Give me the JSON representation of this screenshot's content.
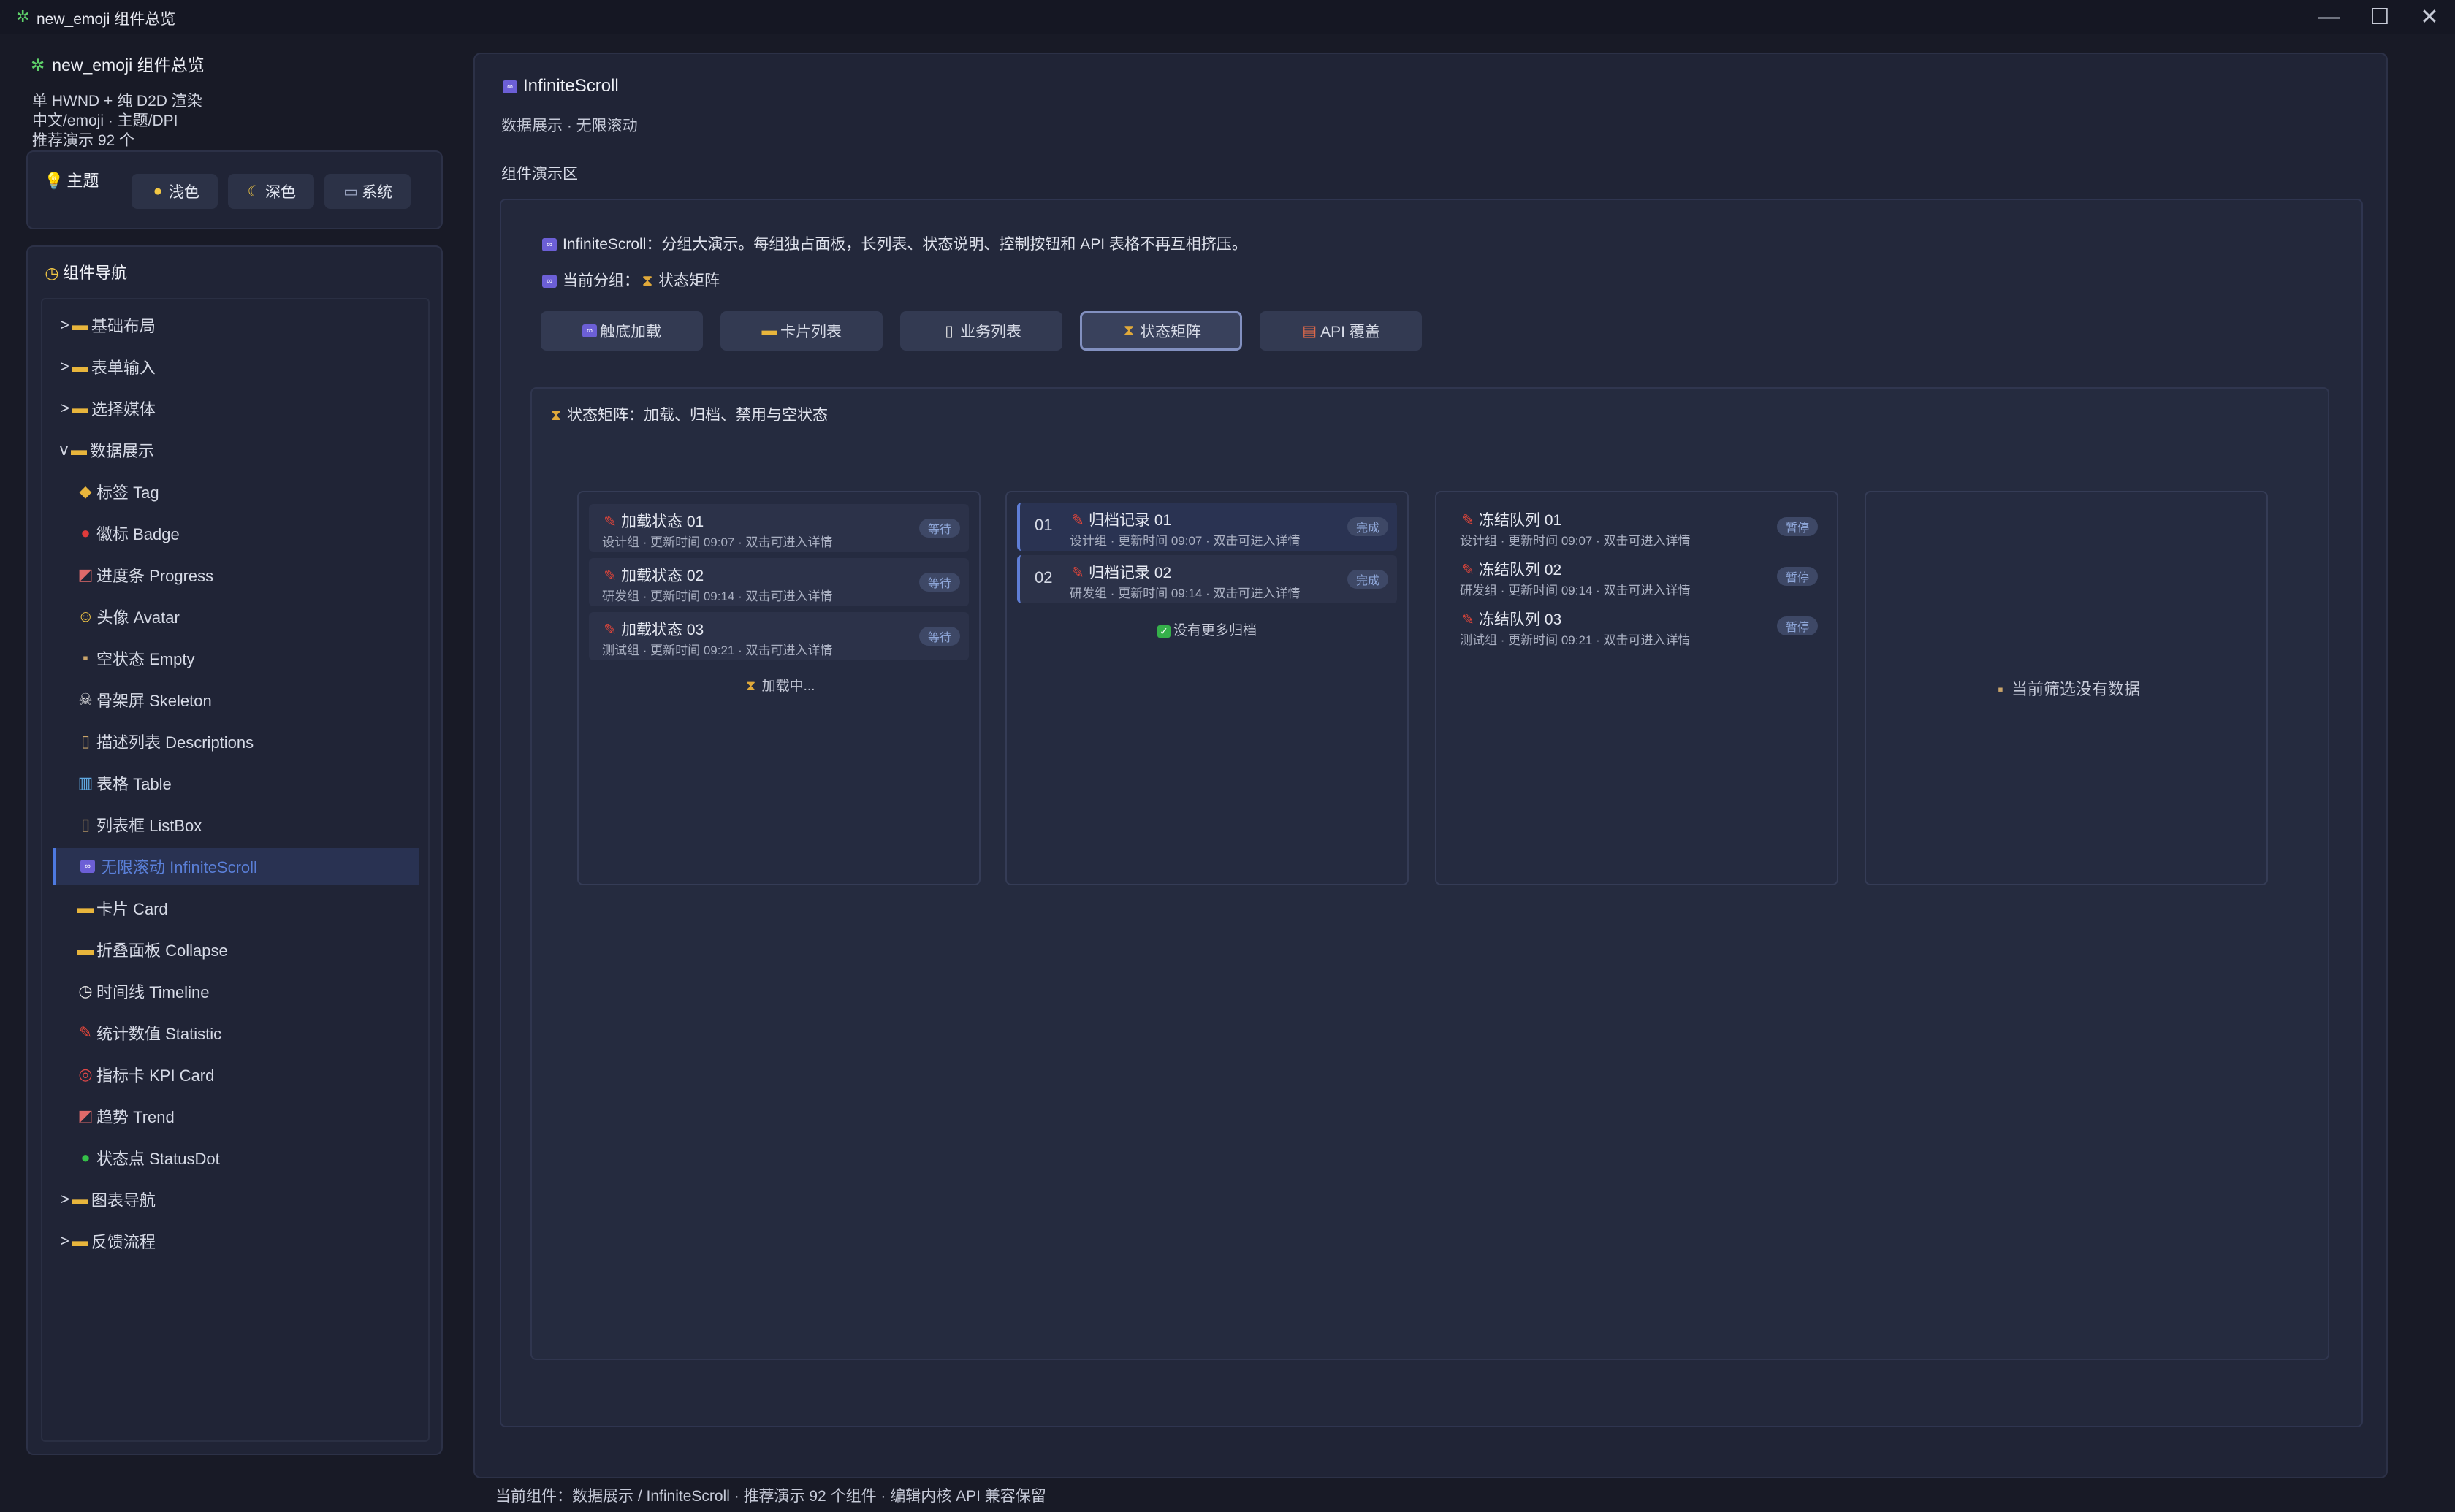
{
  "window": {
    "title": "new_emoji 组件总览",
    "controls": {
      "minimize": "—",
      "maximize": "☐",
      "close": "✕"
    }
  },
  "sidebar": {
    "heading": "new_emoji 组件总览",
    "info": [
      "单 HWND + 纯 D2D 渲染",
      "中文/emoji · 主题/DPI",
      "推荐演示 92 个"
    ],
    "theme": {
      "label": "主题",
      "buttons": [
        {
          "icon": "sun-icon",
          "label": "浅色"
        },
        {
          "icon": "moon-icon",
          "label": "深色"
        },
        {
          "icon": "laptop-icon",
          "label": "系统"
        }
      ]
    },
    "nav": {
      "title": "组件导航",
      "items": [
        {
          "label": "基础布局",
          "glyph": ">",
          "icon": "folder-icon"
        },
        {
          "label": "表单输入",
          "glyph": ">",
          "icon": "folder-icon"
        },
        {
          "label": "选择媒体",
          "glyph": ">",
          "icon": "folder-icon"
        },
        {
          "label": "数据展示",
          "glyph": "v",
          "icon": "folder-open-icon"
        },
        {
          "label": "标签 Tag",
          "icon": "tag-icon"
        },
        {
          "label": "徽标 Badge",
          "icon": "red-circle-icon"
        },
        {
          "label": "进度条 Progress",
          "icon": "chart-up-icon"
        },
        {
          "label": "头像 Avatar",
          "icon": "smiley-icon"
        },
        {
          "label": "空状态 Empty",
          "icon": "mailbox-icon"
        },
        {
          "label": "骨架屏 Skeleton",
          "icon": "skull-icon"
        },
        {
          "label": "描述列表 Descriptions",
          "icon": "clipboard-icon"
        },
        {
          "label": "表格 Table",
          "icon": "bar-chart-icon"
        },
        {
          "label": "列表框 ListBox",
          "icon": "clipboard-icon"
        },
        {
          "label": "无限滚动 InfiniteScroll",
          "icon": "infinity-icon"
        },
        {
          "label": "卡片 Card",
          "icon": "card-icon"
        },
        {
          "label": "折叠面板 Collapse",
          "icon": "folder-icon"
        },
        {
          "label": "时间线 Timeline",
          "icon": "clock-icon"
        },
        {
          "label": "统计数值 Statistic",
          "icon": "pin-icon"
        },
        {
          "label": "指标卡 KPI Card",
          "icon": "target-icon"
        },
        {
          "label": "趋势 Trend",
          "icon": "chart-up-icon"
        },
        {
          "label": "状态点 StatusDot",
          "icon": "green-circle-icon"
        },
        {
          "label": "图表导航",
          "glyph": ">",
          "icon": "folder-icon"
        },
        {
          "label": "反馈流程",
          "glyph": ">",
          "icon": "folder-icon"
        }
      ],
      "active_index": 13
    }
  },
  "main": {
    "title": "InfiniteScroll",
    "subtitle": "数据展示 · 无限滚动",
    "demo_label": "组件演示区",
    "intro": "InfiniteScroll：分组大演示。每组独占面板，长列表、状态说明、控制按钮和 API 表格不再互相挤压。",
    "current_group_label": "当前分组：",
    "current_group": "状态矩阵",
    "tabs": [
      {
        "icon": "infinity-icon",
        "label": "触底加载"
      },
      {
        "icon": "card-icon",
        "label": "卡片列表"
      },
      {
        "icon": "page-icon",
        "label": "业务列表"
      },
      {
        "icon": "hourglass-icon",
        "label": "状态矩阵",
        "active": true
      },
      {
        "icon": "books-icon",
        "label": "API 覆盖"
      }
    ],
    "matrix": {
      "title": "状态矩阵：加载、归档、禁用与空状态",
      "columns": [
        {
          "rows": [
            {
              "title": "加载状态 01",
              "sub": "设计组 · 更新时间 09:07 · 双击可进入详情",
              "badge": "等待"
            },
            {
              "title": "加载状态 02",
              "sub": "研发组 · 更新时间 09:14 · 双击可进入详情",
              "badge": "等待"
            },
            {
              "title": "加载状态 03",
              "sub": "测试组 · 更新时间 09:21 · 双击可进入详情",
              "badge": "等待"
            }
          ],
          "footer": "加载中..."
        },
        {
          "rows": [
            {
              "num": "01",
              "title": "归档记录 01",
              "sub": "设计组 · 更新时间 09:07 · 双击可进入详情",
              "badge": "完成"
            },
            {
              "num": "02",
              "title": "归档记录 02",
              "sub": "研发组 · 更新时间 09:14 · 双击可进入详情",
              "badge": "完成"
            }
          ],
          "footer": "没有更多归档"
        },
        {
          "rows": [
            {
              "title": "冻结队列 01",
              "sub": "设计组 · 更新时间 09:07 · 双击可进入详情",
              "badge": "暂停"
            },
            {
              "title": "冻结队列 02",
              "sub": "研发组 · 更新时间 09:14 · 双击可进入详情",
              "badge": "暂停"
            },
            {
              "title": "冻结队列 03",
              "sub": "测试组 · 更新时间 09:21 · 双击可进入详情",
              "badge": "暂停"
            }
          ]
        },
        {
          "empty": "当前筛选没有数据"
        }
      ]
    }
  },
  "status_bar": "当前组件：数据展示 / InfiniteScroll · 推荐演示 92 个组件 · 编辑内核 API 兼容保留"
}
